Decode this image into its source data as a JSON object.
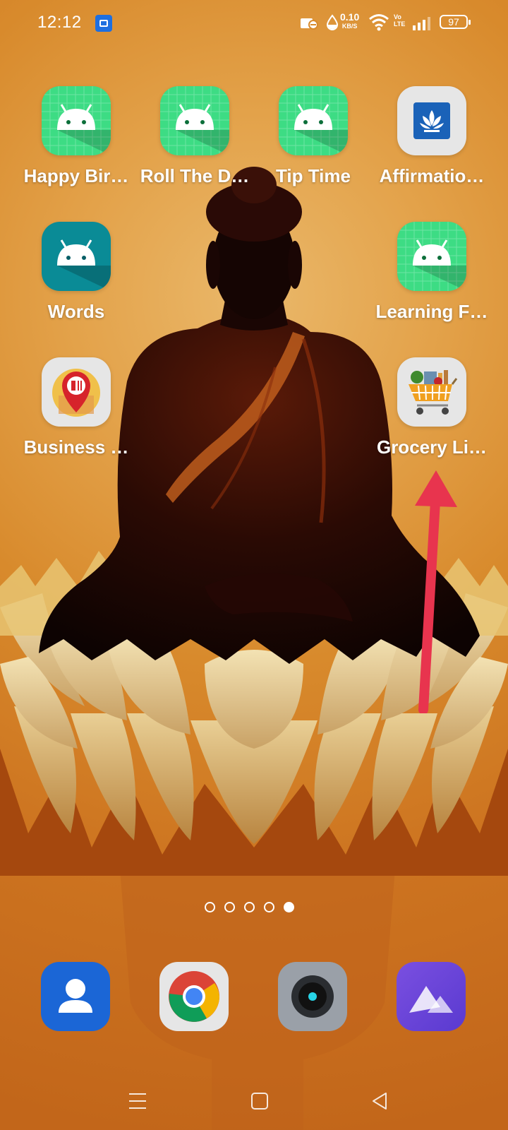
{
  "status_bar": {
    "time": "12:12",
    "net_speed_value": "0.10",
    "net_speed_unit": "KB/S",
    "volte_top": "Vo",
    "volte_bottom": "LTE",
    "battery": "97"
  },
  "home": {
    "apps": [
      {
        "label": "Happy Bir…",
        "icon": "android-icon"
      },
      {
        "label": "Roll The D…",
        "icon": "android-icon"
      },
      {
        "label": "Tip Time",
        "icon": "android-icon"
      },
      {
        "label": "Affirmatio…",
        "icon": "lotus-icon"
      },
      {
        "label": "Words",
        "icon": "android-icon"
      },
      {
        "label": "Learning F…",
        "icon": "android-icon"
      },
      {
        "label": "Business …",
        "icon": "map-pin-icon"
      },
      {
        "label": "Grocery Li…",
        "icon": "grocery-cart-icon"
      }
    ],
    "page_indicator": {
      "count": 5,
      "active": 5
    }
  },
  "dock": {
    "apps": [
      {
        "icon": "contacts-icon"
      },
      {
        "icon": "chrome-icon"
      },
      {
        "icon": "camera-icon"
      },
      {
        "icon": "gallery-icon"
      }
    ]
  },
  "navigation": {
    "buttons": [
      "menu-icon",
      "home-icon",
      "back-icon"
    ]
  },
  "colors": {
    "annotation_arrow": "#e8344e",
    "android_green": "#3ddc84",
    "android_teal": "#0a8b96"
  }
}
